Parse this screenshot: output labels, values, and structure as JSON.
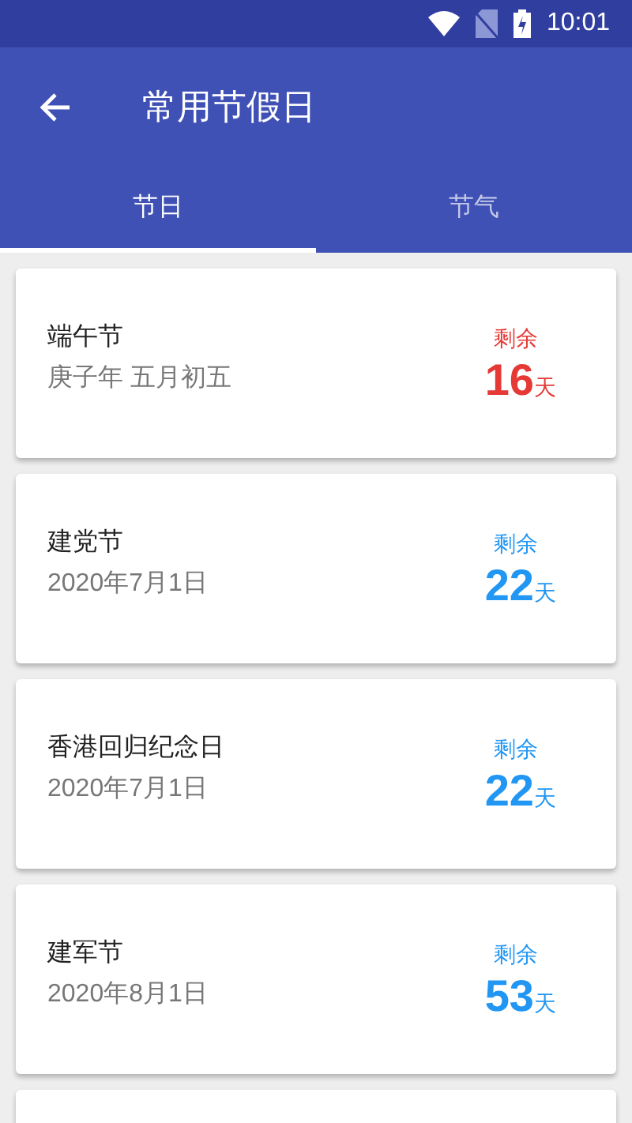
{
  "status_bar": {
    "time": "10:01"
  },
  "toolbar": {
    "title": "常用节假日"
  },
  "tabs": [
    {
      "label": "节日",
      "selected": true
    },
    {
      "label": "节气",
      "selected": false
    }
  ],
  "holidays": [
    {
      "name": "端午节",
      "date": "庚子年 五月初五",
      "remaining_label": "剩余",
      "days": "16",
      "unit": "天",
      "color": "#e53935"
    },
    {
      "name": "建党节",
      "date": "2020年7月1日",
      "remaining_label": "剩余",
      "days": "22",
      "unit": "天",
      "color": "#2196f3"
    },
    {
      "name": "香港回归纪念日",
      "date": "2020年7月1日",
      "remaining_label": "剩余",
      "days": "22",
      "unit": "天",
      "color": "#2196f3"
    },
    {
      "name": "建军节",
      "date": "2020年8月1日",
      "remaining_label": "剩余",
      "days": "53",
      "unit": "天",
      "color": "#2196f3"
    }
  ]
}
